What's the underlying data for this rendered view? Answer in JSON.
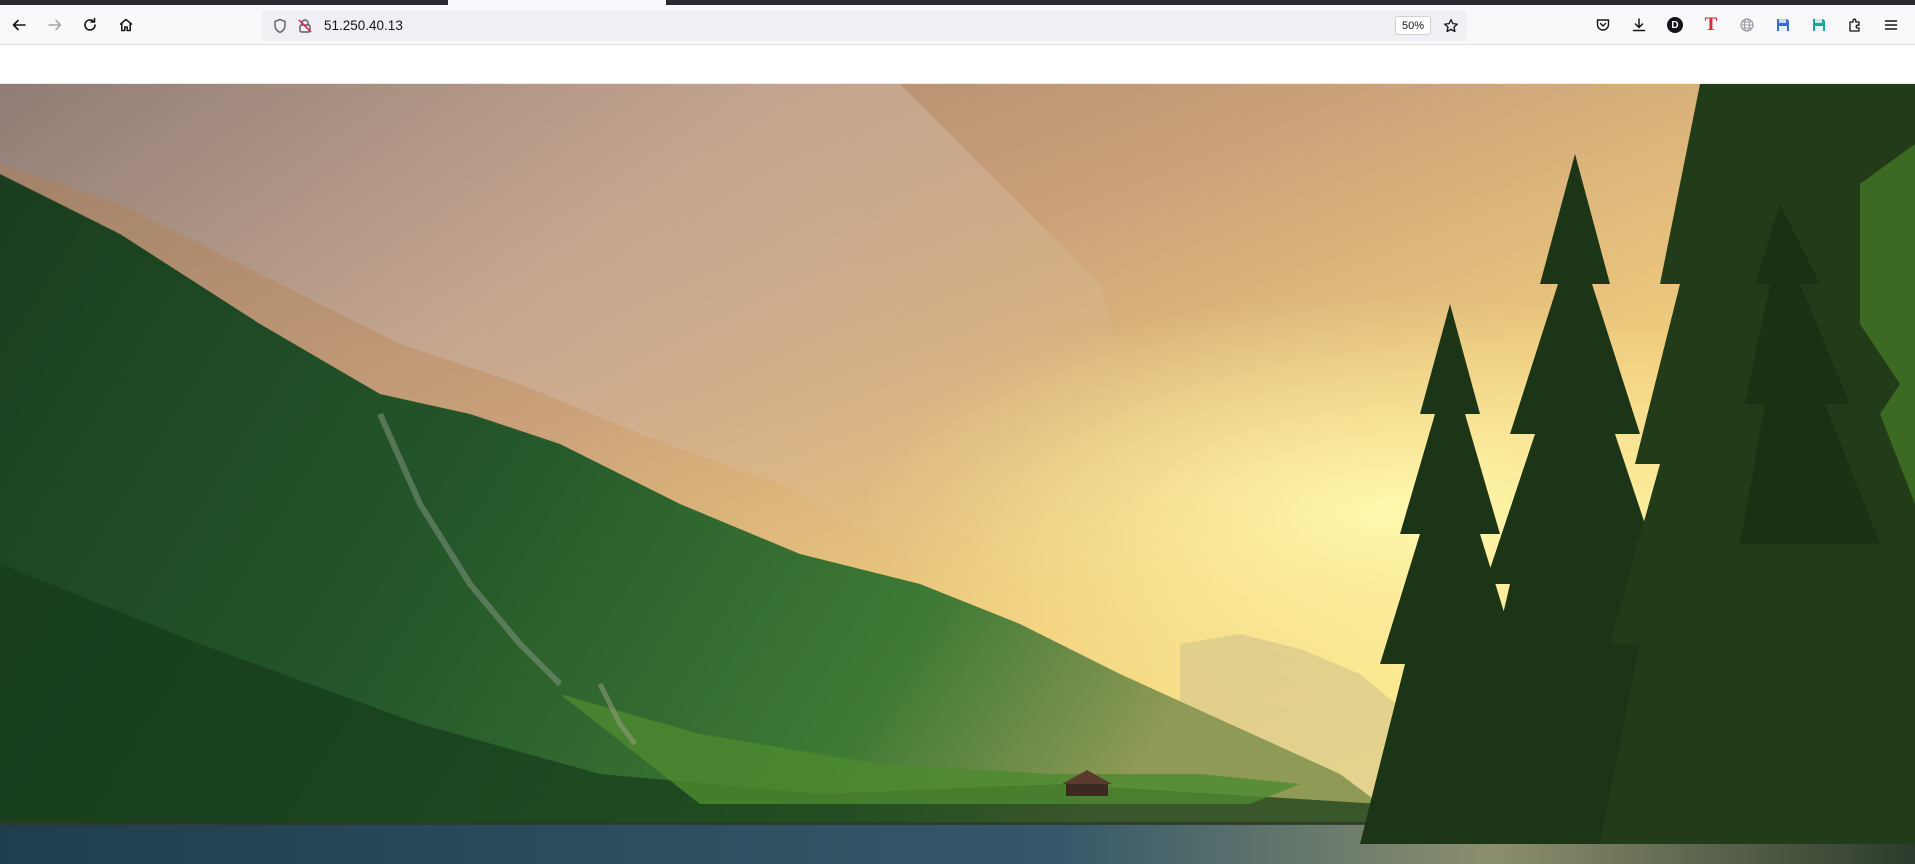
{
  "browser": {
    "url": "51.250.40.13",
    "zoom": "50%",
    "nav": {
      "back": "arrow-left-icon",
      "forward": "arrow-right-icon",
      "reload": "reload-icon",
      "home": "home-icon"
    },
    "urlbar_icons": [
      "shield-icon",
      "insecure-lock-icon"
    ],
    "bookmark_icon": "star-icon",
    "toolbar_icons": [
      "pocket-icon",
      "download-icon",
      "account-d-icon",
      "t-extension-icon",
      "globe-icon",
      "save-blue-icon",
      "save-teal-icon",
      "extensions-puzzle-icon",
      "hamburger-menu-icon"
    ],
    "account_letter": "D",
    "t_letter": "T"
  },
  "page": {
    "hero_image": "mountain-lake-landscape"
  },
  "colors": {
    "sky_top": "#a88566",
    "sky_glow": "#fff59a",
    "mountain": "#1f4a22",
    "trees": "#1e3618",
    "water": "#24424f"
  }
}
